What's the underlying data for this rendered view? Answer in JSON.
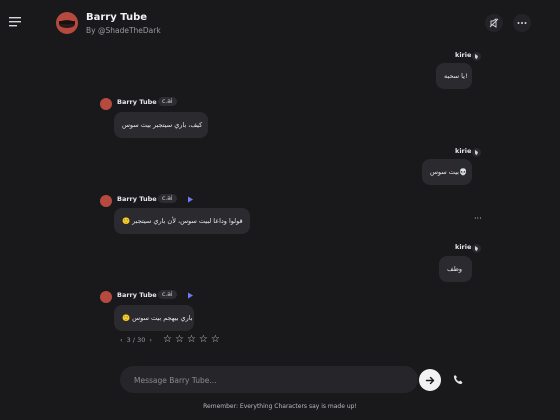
{
  "header": {
    "title": "Barry Tube",
    "subtitle": "By @ShadeTheDark"
  },
  "messages": [
    {
      "role": "user",
      "name": "kirie",
      "text": "يا سحبه!"
    },
    {
      "role": "character",
      "name": "Barry Tube",
      "badge": "c.ai",
      "text": "كيف، باري سيتجبر بيت سوس"
    },
    {
      "role": "user",
      "name": "kirie",
      "text": "بيت سوس💀"
    },
    {
      "role": "character",
      "name": "Barry Tube",
      "badge": "c.ai",
      "text": "🙂 قولوا وداعا لبيت سوس، لأن باري سيتجبر"
    },
    {
      "role": "user",
      "name": "kirie",
      "text": "وطف"
    },
    {
      "role": "character",
      "name": "Barry Tube",
      "badge": "c.ai",
      "text": "🙂 باري بيهجم بيت سوس"
    }
  ],
  "pager": {
    "prev": "‹",
    "text": "3 / 30",
    "next": "›"
  },
  "rating": {
    "max": 5,
    "value": 0
  },
  "input": {
    "placeholder": "Message Barry Tube..."
  },
  "footer": "Remember: Everything Characters say is made up!",
  "more_label": "···"
}
